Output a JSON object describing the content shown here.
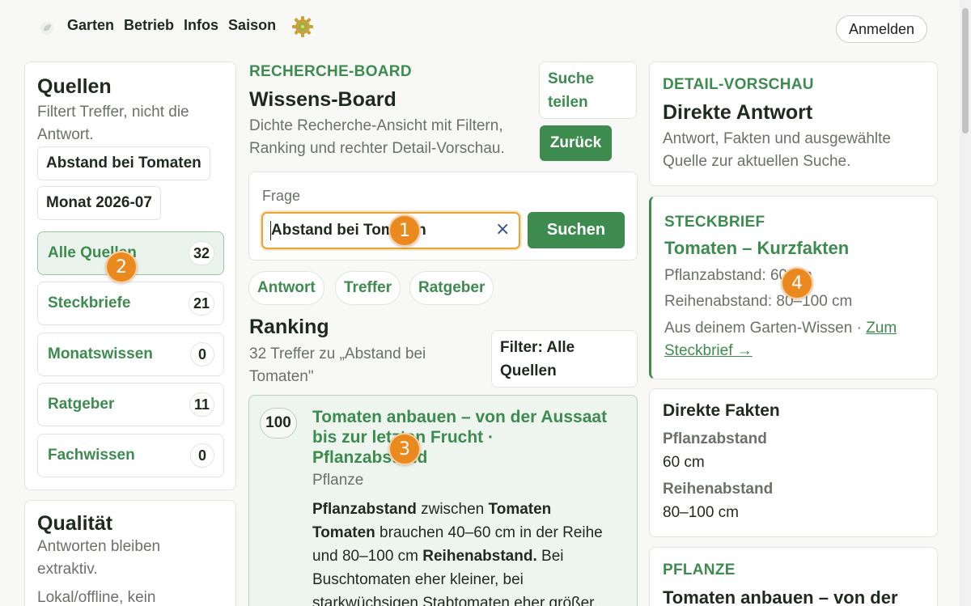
{
  "nav": {
    "links": [
      "Garten",
      "Betrieb",
      "Infos",
      "Saison"
    ],
    "login_label": "Anmelden"
  },
  "sources": {
    "title": "Quellen",
    "subtitle": "Filtert Treffer, nicht die Antwort.",
    "query_chip": "Abstand bei Tomaten",
    "month_chip": "Monat 2026-07",
    "items": [
      {
        "label": "Alle Quellen",
        "count": "32",
        "active": true
      },
      {
        "label": "Steckbriefe",
        "count": "21",
        "active": false
      },
      {
        "label": "Monatswissen",
        "count": "0",
        "active": false
      },
      {
        "label": "Ratgeber",
        "count": "11",
        "active": false
      },
      {
        "label": "Fachwissen",
        "count": "0",
        "active": false
      }
    ]
  },
  "quality": {
    "title": "Qualität",
    "subtitle": "Antworten bleiben extraktiv.",
    "note": "Lokal/offline, kein"
  },
  "board": {
    "eyebrow": "RECHERCHE-BOARD",
    "title": "Wissens-Board",
    "subtitle": "Dichte Recherche-Ansicht mit Filtern, Ranking und rechter Detail-Vorschau.",
    "share_label": "Suche teilen",
    "back_label": "Zurück",
    "question_label": "Frage",
    "search_value": "Abstand bei Tomaten",
    "search_button": "Suchen",
    "tabs": [
      "Antwort",
      "Treffer",
      "Ratgeber"
    ],
    "ranking_title": "Ranking",
    "ranking_sub": "32 Treffer zu „Abstand bei Tomaten\"",
    "filter_label": "Filter: Alle Quellen",
    "result": {
      "score": "100",
      "title": "Tomaten anbauen – von der Aussaat bis zur letzten Frucht · Pflanzabstand",
      "category": "Pflanze",
      "snippet_1_bold": "Pflanzabstand",
      "snippet_1_rest": " zwischen ",
      "snippet_1_bold2": "Tomaten",
      "snippet_2_bold": "Tomaten",
      "snippet_2_rest": " brauchen 40–60 cm in der Reihe und 80–100 cm ",
      "snippet_2_bold2": "Reihenabstand.",
      "snippet_3": "Bei Buschtomaten eher kleiner, bei starkwüchsigen Stabtomaten eher größer."
    }
  },
  "detail": {
    "eyebrow": "DETAIL-VORSCHAU",
    "title": "Direkte Antwort",
    "subtitle": "Antwort, Fakten und ausgewählte Quelle zur aktuellen Suche.",
    "card_eyebrow": "STECKBRIEF",
    "card_title": "Tomaten – Kurzfakten",
    "line1": "Pflanzabstand: 60 cm",
    "line2": "Reihenabstand: 80–100 cm",
    "source_prefix": "Aus deinem Garten-Wissen · ",
    "source_link": "Zum Steckbrief →",
    "facts_title": "Direkte Fakten",
    "facts": [
      {
        "label": "Pflanzabstand",
        "value": "60 cm"
      },
      {
        "label": "Reihenabstand",
        "value": "80–100 cm"
      }
    ],
    "plant_eyebrow": "PFLANZE",
    "plant_title": "Tomaten anbauen – von der"
  },
  "badges": [
    "1",
    "2",
    "3",
    "4"
  ],
  "colors": {
    "accent": "#3d8b4f",
    "badge": "#ea8a1e",
    "active_bg": "#eaf3ec",
    "focus_border": "#e8a33a"
  }
}
